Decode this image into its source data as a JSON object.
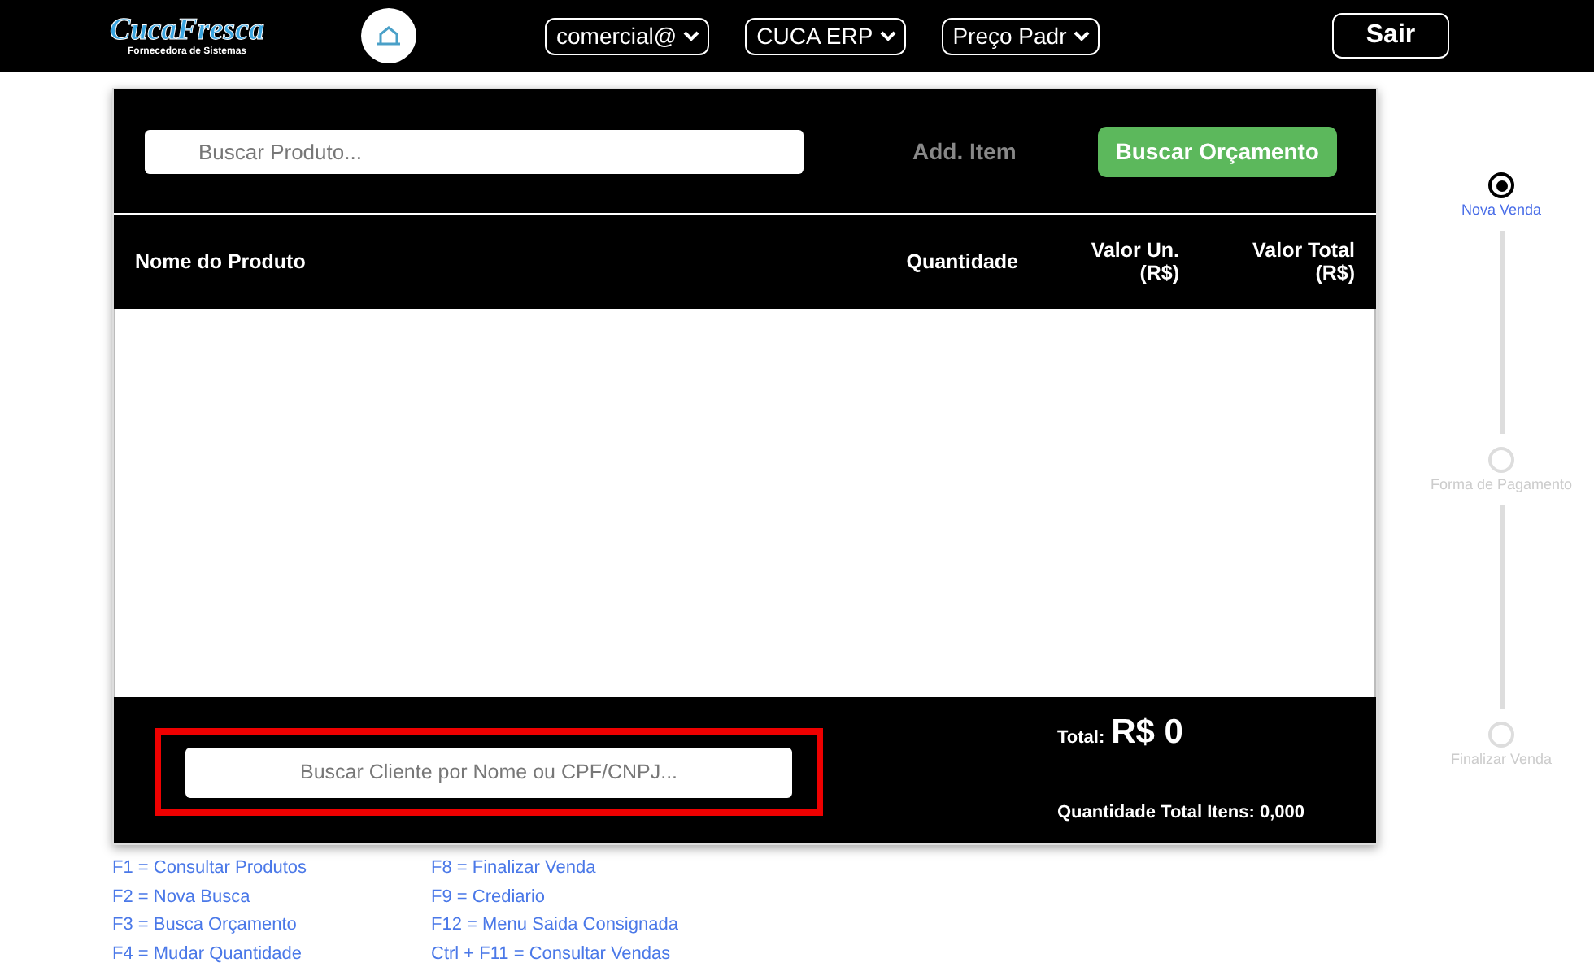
{
  "header": {
    "logo": {
      "title": "CucaFresca",
      "subtitle": "Fornecedora de Sistemas"
    },
    "selects": [
      {
        "value": "comercial@"
      },
      {
        "value": "CUCA ERP"
      },
      {
        "value": "Preço Padr"
      }
    ],
    "logout": "Sair"
  },
  "search": {
    "placeholder": "Buscar Produto...",
    "add": "Add. Item",
    "budget": "Buscar Orçamento"
  },
  "table": {
    "columns": [
      {
        "label": "Nome do Produto"
      },
      {
        "label": "Quantidade"
      },
      {
        "label": "Valor Un. (R$)"
      },
      {
        "label": "Valor Total (R$)"
      }
    ]
  },
  "footer": {
    "client_placeholder": "Buscar Cliente por Nome ou CPF/CNPJ...",
    "highlighted": true,
    "total_label": "Total:",
    "total_value": "R$ 0",
    "quantity": "Quantidade Total Itens: 0,000"
  },
  "steps": [
    {
      "label": "Nova Venda",
      "selected": true
    },
    {
      "label": "Forma de Pagamento",
      "selected": false
    },
    {
      "label": "Finalizar Venda",
      "selected": false
    }
  ],
  "shortcuts": [
    [
      "F1 = Consultar Produtos",
      "F2 = Nova Busca",
      "F3 = Busca Orçamento",
      "F4 = Mudar Quantidade"
    ],
    [
      "F8 = Finalizar Venda",
      "F9 = Crediario",
      "F12 = Menu Saida Consignada",
      "Ctrl + F11 = Consultar Vendas"
    ]
  ]
}
